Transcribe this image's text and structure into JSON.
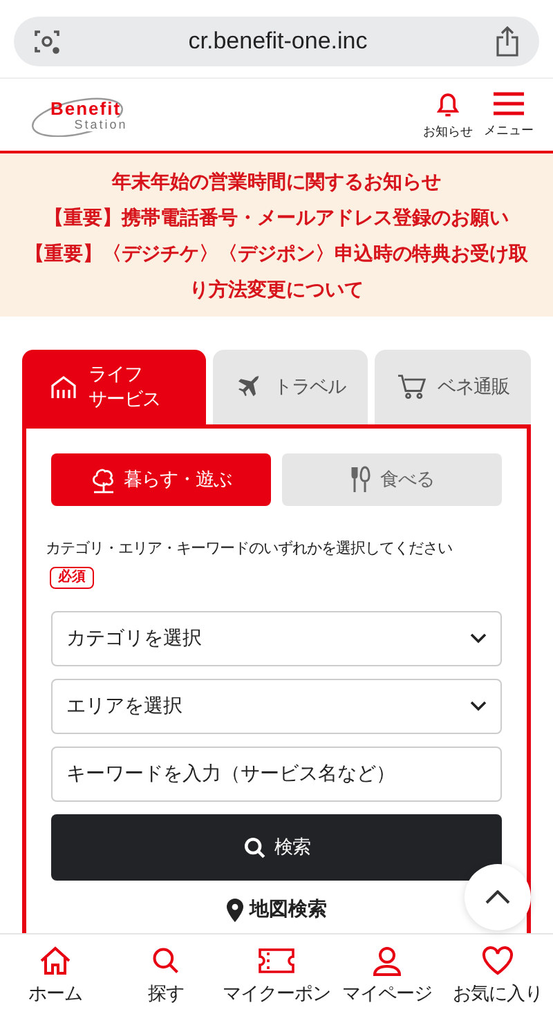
{
  "browser": {
    "url": "cr.benefit-one.inc"
  },
  "header": {
    "logo": {
      "line1": "Benefit",
      "line2": "Station"
    },
    "actions": [
      {
        "kind": "bell",
        "label": "お知らせ"
      },
      {
        "kind": "menu",
        "label": "メニュー"
      }
    ]
  },
  "notices": [
    "年末年始の営業時間に関するお知らせ",
    "【重要】携帯電話番号・メールアドレス登録のお願い",
    "【重要】〈デジチケ〉〈デジポン〉申込時の特典お受け取り方法変更について"
  ],
  "tabs": [
    {
      "kind": "life",
      "lines": [
        "ライフ",
        "サービス"
      ],
      "selected": true
    },
    {
      "kind": "travel",
      "lines": [
        "トラベル"
      ],
      "selected": false
    },
    {
      "kind": "shop",
      "lines": [
        "ベネ通販"
      ],
      "selected": false
    }
  ],
  "subtabs": [
    {
      "kind": "play",
      "label": "暮らす・遊ぶ",
      "selected": true
    },
    {
      "kind": "eat",
      "label": "食べる",
      "selected": false
    }
  ],
  "instruction": "カテゴリ・エリア・キーワードのいずれかを選択してください",
  "required_badge": "必須",
  "selects": [
    {
      "label": "カテゴリを選択"
    },
    {
      "label": "エリアを選択"
    }
  ],
  "keyword": {
    "placeholder": "キーワードを入力（サービス名など）"
  },
  "search_button": "検索",
  "map_search": "地図検索",
  "bottom_nav": [
    {
      "kind": "home",
      "label": "ホーム"
    },
    {
      "kind": "search",
      "label": "探す"
    },
    {
      "kind": "coupon",
      "label": "マイクーポン"
    },
    {
      "kind": "person",
      "label": "マイページ"
    },
    {
      "kind": "heart",
      "label": "お気に入り"
    }
  ]
}
